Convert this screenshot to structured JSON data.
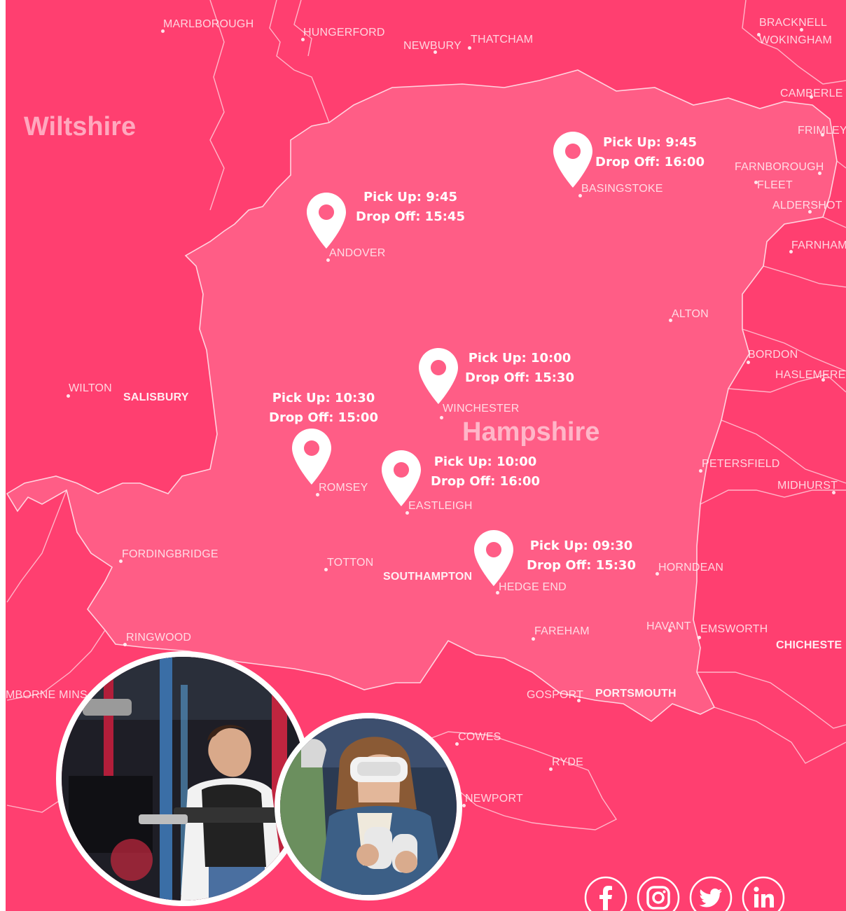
{
  "colors": {
    "background": "#ff3f70",
    "county": "#ff5d86",
    "border": "#ffd3df",
    "pin": "#ffffff",
    "text": "#ffffff"
  },
  "regions": {
    "wiltshire": "Wiltshire",
    "hampshire": "Hampshire"
  },
  "towns": {
    "marlborough": "MARLBOROUGH",
    "hungerford": "HUNGERFORD",
    "newbury": "NEWBURY",
    "thatcham": "THATCHAM",
    "bracknell": "BRACKNELL",
    "wokingham": "WOKINGHAM",
    "camberley": "CAMBERLE",
    "frimley": "FRIMLEY",
    "farnborough": "FARNBOROUGH",
    "fleet": "FLEET",
    "aldershot": "ALDERSHOT",
    "farnham": "FARNHAM",
    "basingstoke": "BASINGSTOKE",
    "andover": "ANDOVER",
    "alton": "ALTON",
    "bordon": "BORDON",
    "haslemere": "HASLEMERE",
    "wilton": "WILTON",
    "salisbury": "SALISBURY",
    "winchester": "WINCHESTER",
    "romsey": "ROMSEY",
    "eastleigh": "EASTLEIGH",
    "petersfield": "PETERSFIELD",
    "midhurst": "MIDHURST",
    "fordingbridge": "FORDINGBRIDGE",
    "totton": "TOTTON",
    "southampton": "SOUTHAMPTON",
    "hedge_end": "HEDGE END",
    "horndean": "HORNDEAN",
    "ringwood": "RINGWOOD",
    "fareham": "FAREHAM",
    "havant": "HAVANT",
    "emsworth": "EMSWORTH",
    "chichester": "CHICHESTE",
    "wimborne": "MBORNE MINS",
    "gosport": "GOSPORT",
    "portsmouth": "PORTSMOUTH",
    "cowes": "COWES",
    "ryde": "RYDE",
    "newport": "NEWPORT"
  },
  "stops": {
    "basingstoke": {
      "pickup": "Pick Up: 9:45",
      "dropoff": "Drop Off: 16:00"
    },
    "andover": {
      "pickup": "Pick Up: 9:45",
      "dropoff": "Drop Off: 15:45"
    },
    "winchester": {
      "pickup": "Pick Up: 10:00",
      "dropoff": "Drop Off: 15:30"
    },
    "romsey": {
      "pickup": "Pick Up: 10:30",
      "dropoff": "Drop Off: 15:00"
    },
    "eastleigh": {
      "pickup": "Pick Up: 10:00",
      "dropoff": "Drop Off: 16:00"
    },
    "hedge_end": {
      "pickup": "Pick Up: 09:30",
      "dropoff": "Drop Off: 15:30"
    }
  },
  "icons": {
    "pin": "map-pin-icon",
    "facebook": "facebook-icon",
    "instagram": "instagram-icon",
    "twitter": "twitter-icon",
    "linkedin": "linkedin-icon"
  }
}
